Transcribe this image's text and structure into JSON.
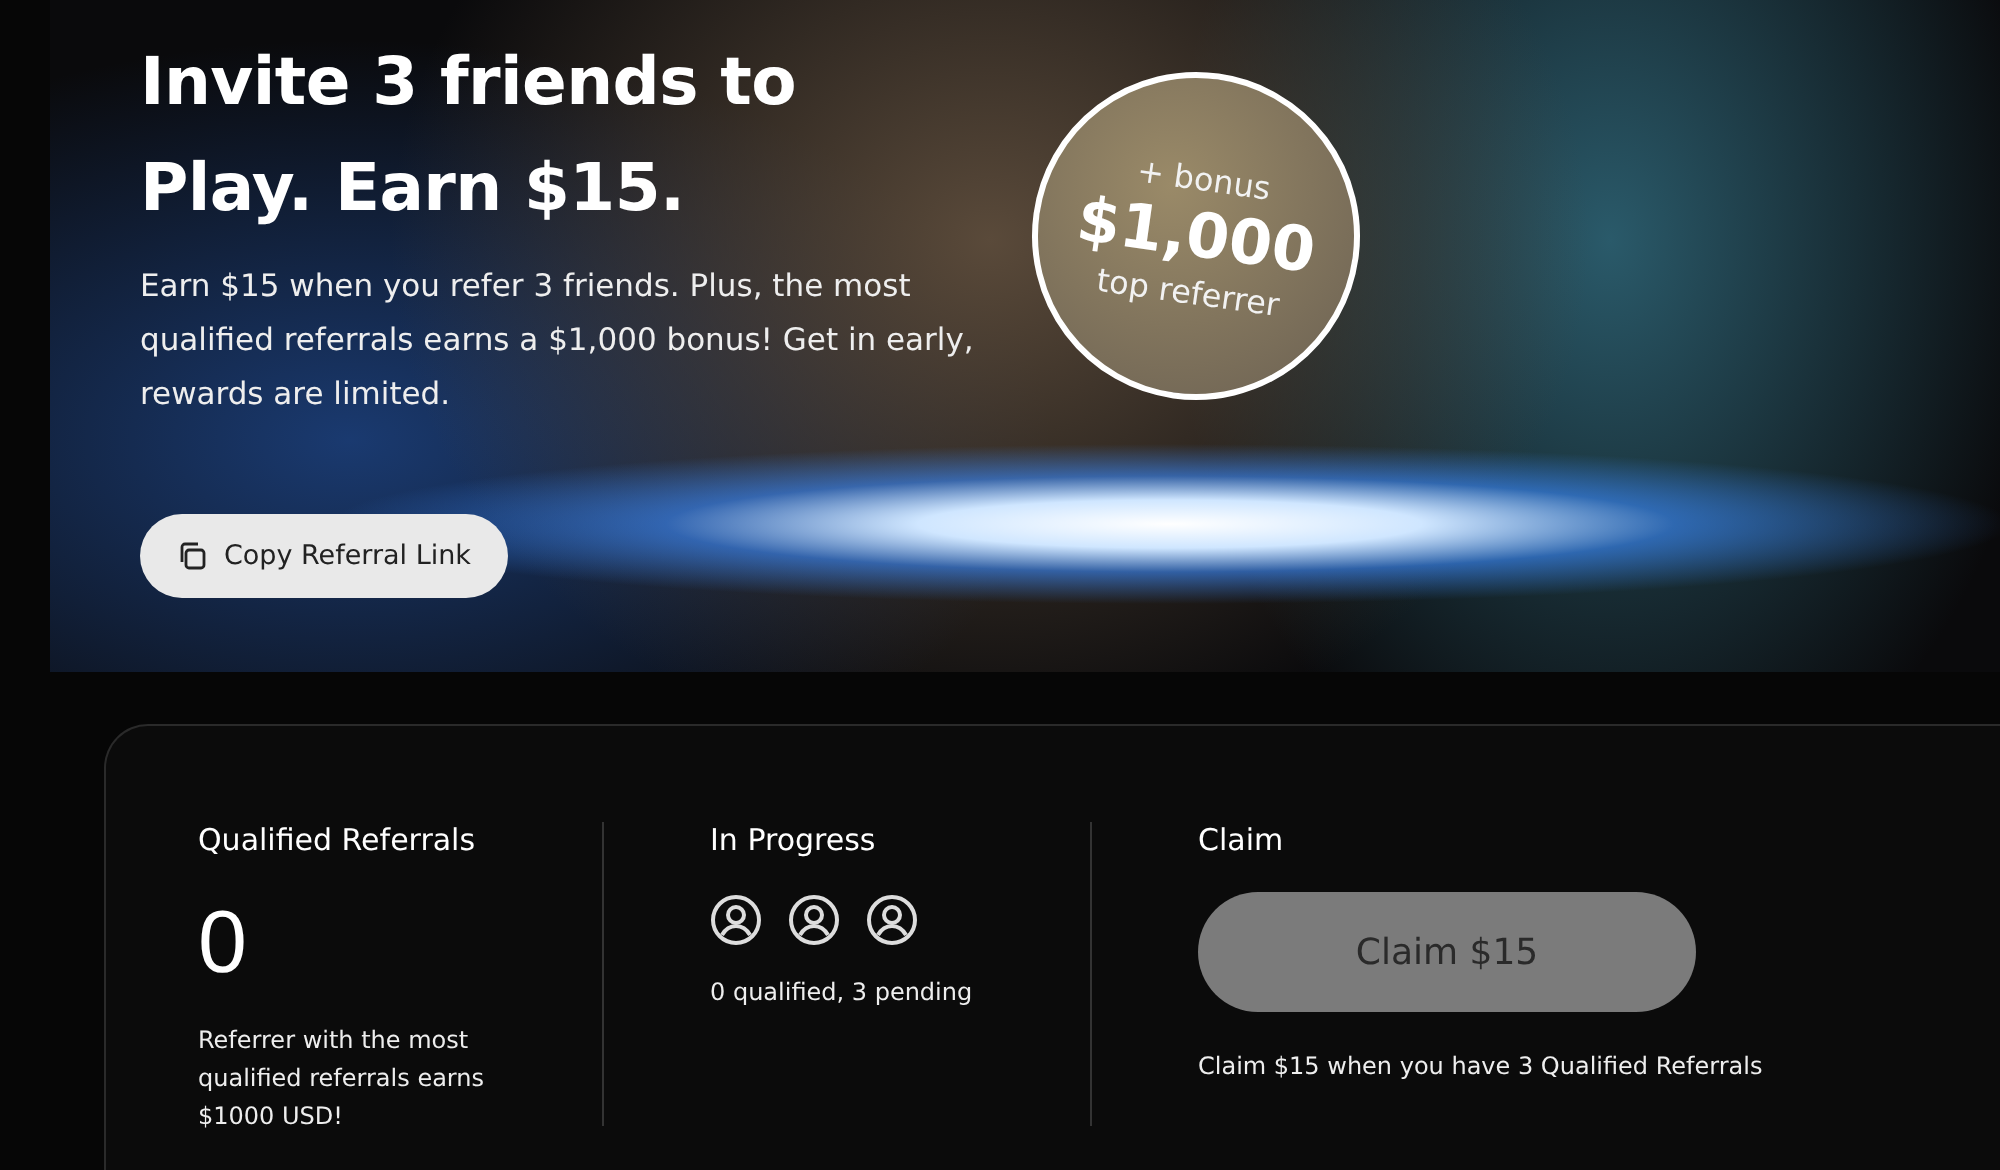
{
  "hero": {
    "title_lines": [
      "Invite 3 friends to",
      "Play. Earn $15."
    ],
    "description": "Earn $15 when you refer 3 friends. Plus, the most qualified referrals earns a $1,000 bonus! Get in early, rewards are limited.",
    "copy_button": "Copy Referral Link",
    "badge": {
      "top": "+ bonus",
      "amount": "$1,000",
      "bottom": "top referrer"
    }
  },
  "stats": {
    "qualified": {
      "label": "Qualified Referrals",
      "count": "0",
      "note": "Referrer with the most qualified referrals earns $1000 USD!"
    },
    "in_progress": {
      "label": "In Progress",
      "slots": [
        {
          "qualified": false
        },
        {
          "qualified": false
        },
        {
          "qualified": false
        }
      ],
      "summary": "0 qualified, 3 pending"
    },
    "claim": {
      "label": "Claim",
      "button": "Claim $15",
      "disabled": true,
      "note": "Claim $15 when you have 3 Qualified Referrals"
    }
  }
}
